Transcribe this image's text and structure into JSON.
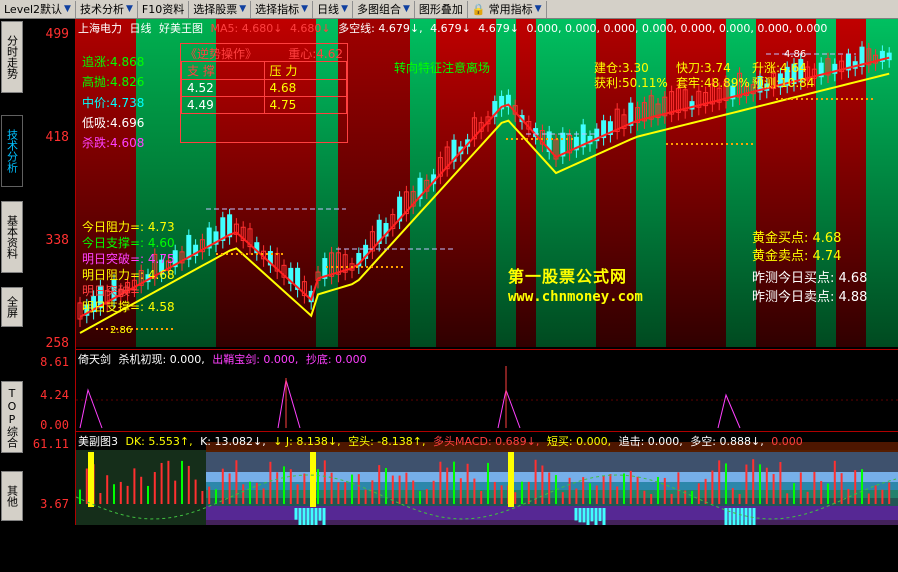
{
  "toolbar": {
    "items": [
      {
        "label": "Level2默认"
      },
      {
        "label": "技术分析"
      },
      {
        "label": "F10资料"
      },
      {
        "label": "选择股票"
      },
      {
        "label": "选择指标"
      },
      {
        "label": "日线"
      },
      {
        "label": "多图组合"
      },
      {
        "label": "图形叠加"
      },
      {
        "label": "常用指标"
      }
    ]
  },
  "sidetabs": [
    {
      "label": "分时走势"
    },
    {
      "label": "技术分析"
    },
    {
      "label": "基本资料"
    },
    {
      "label": "全屏"
    },
    {
      "label": "TOP综合"
    },
    {
      "label": "其他"
    }
  ],
  "yaxis": {
    "main": [
      "499",
      "418",
      "338",
      "258"
    ],
    "pane2": [
      "8.61",
      "4.24",
      "0.00"
    ],
    "pane3": [
      "61.11",
      "3.67"
    ]
  },
  "main": {
    "header": {
      "stock": "上海电力",
      "period": "日线",
      "indicator": "好美王图",
      "ma5": "MA5: 4.680↓",
      "v2": "4.680↓",
      "duokong": "多空线: 4.679↓,",
      "v4": "4.679↓",
      "v5": "4.679↓",
      "zeros": "0.000, 0.000, 0.000, 0.000, 0.000, 0.000, 0.000, 0.000"
    },
    "left_labels": {
      "zhuizhang": "追涨:4.868",
      "gaopao": "高抛:4.826",
      "zhongjia": "中价:4.738",
      "dixi": "低吸:4.696",
      "shadie": "杀跌:4.608"
    },
    "ops_box": {
      "title": "《逆势操作》",
      "center": "重心:4.62",
      "col_support": "支 撑",
      "col_pressure": "压 力",
      "rows": [
        {
          "support": "4.52",
          "pressure": "4.68"
        },
        {
          "support": "4.49",
          "pressure": "4.75"
        }
      ]
    },
    "today": {
      "resist": "今日阻力=: 4.73",
      "support": "今日支撑=: 4.60",
      "break": "明日突破=: 4.75",
      "tomorrow_resist": "明日阻力=: 4.68",
      "tomorrow_break": "明日突破=",
      "tomorrow_support": "明日支撑=: 4.58"
    },
    "annotations": {
      "trend_turn": "转向特征注意离场",
      "jiancang": "建仓:3.30",
      "huoli": "获利:50.11%",
      "kuaidao": "快刀:3.74",
      "taoli": "套牢:48.89%",
      "shengtu": "升涨:4.64",
      "yuce": "预测:10.84",
      "price_286": "2.86",
      "price_466": "4.86",
      "b_label": "B",
      "s_label": "S"
    },
    "right_labels": {
      "gold_buy": "黄金买点: 4.68",
      "gold_sell": "黄金卖点: 4.74",
      "yest_buy": "昨测今日买点: 4.68",
      "yest_sell": "昨测今日卖点: 4.88"
    },
    "watermark": {
      "line1": "第一股票公式网",
      "line2": "www.chnmoney.com"
    }
  },
  "pane2": {
    "name": "倚天剑",
    "f1": "杀机初现: 0.000,",
    "f2": "出鞘宝剑: 0.000,",
    "f3": "抄底: 0.000"
  },
  "pane3": {
    "name": "美副图3",
    "dk": "DK: 5.553↑,",
    "k": "K: 13.082↓,",
    "j": "↓ J: 8.138↓,",
    "kongtou": "空头: -8.138↑,",
    "duotou": "多头MACD: 0.689↓,",
    "duanmai": "短买: 0.000,",
    "zhuigao": "追击: 0.000,",
    "duokong": "多空: 0.888↓,",
    "zero": "0.000"
  },
  "colors": {
    "bg": "#000000",
    "red_band": "#c00000",
    "green_band": "#00a040",
    "axis_red": "#ff3030",
    "yellow": "#ffff00"
  }
}
